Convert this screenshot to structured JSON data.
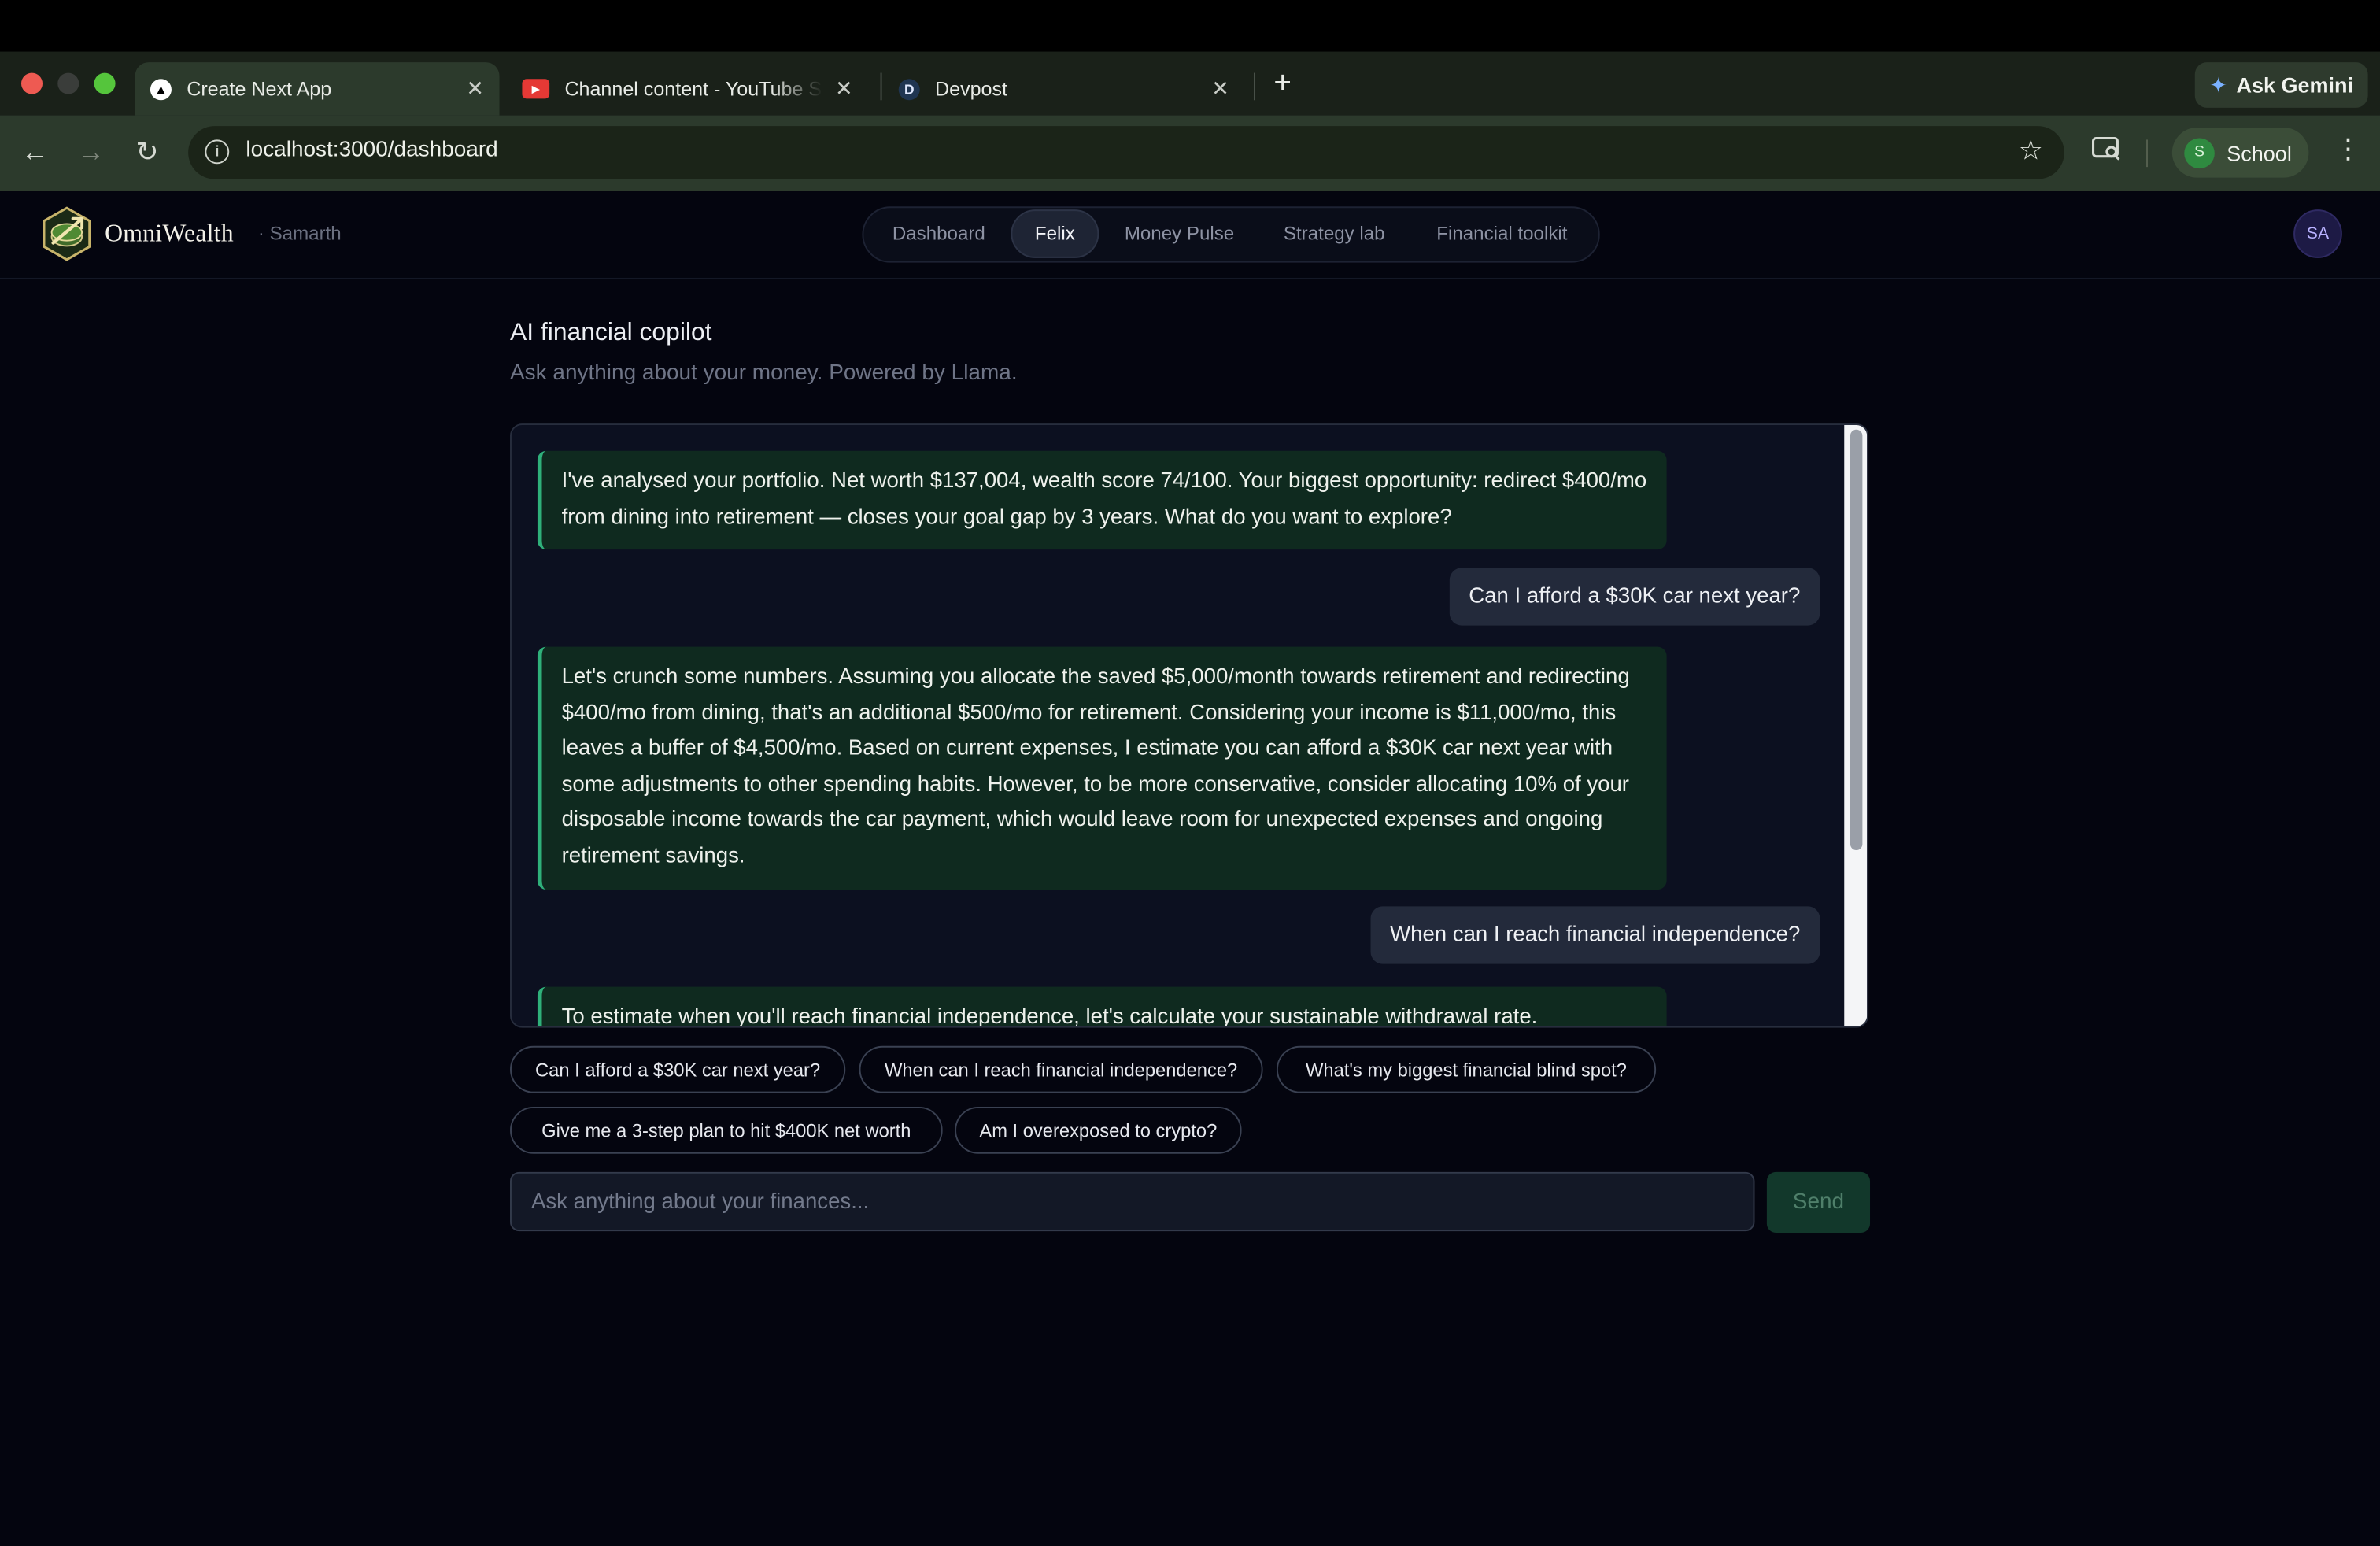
{
  "browser": {
    "tabs": [
      {
        "title": "Create Next App",
        "active": true,
        "favicon": "triangle-icon"
      },
      {
        "title": "Channel content - YouTube Studio",
        "active": false,
        "favicon": "youtube-icon"
      },
      {
        "title": "Devpost",
        "active": false,
        "favicon": "D"
      }
    ],
    "new_tab": "+",
    "ask_gemini": "Ask Gemini",
    "url": "localhost:3000/dashboard",
    "profile_initial": "S",
    "profile_name": "School"
  },
  "app": {
    "brand": "OmniWealth",
    "user": "· Samarth",
    "nav": [
      {
        "label": "Dashboard",
        "active": false
      },
      {
        "label": "Felix",
        "active": true
      },
      {
        "label": "Money Pulse",
        "active": false
      },
      {
        "label": "Strategy lab",
        "active": false
      },
      {
        "label": "Financial toolkit",
        "active": false
      }
    ],
    "avatar_initials": "SA"
  },
  "page": {
    "title": "AI financial copilot",
    "subtitle": "Ask anything about your money. Powered by Llama."
  },
  "messages": [
    {
      "role": "assistant",
      "text": "I've analysed your portfolio. Net worth $137,004, wealth score 74/100. Your biggest opportunity: redirect $400/mo from dining into retirement — closes your goal gap by 3 years. What do you want to explore?"
    },
    {
      "role": "user",
      "text": "Can I afford a $30K car next year?"
    },
    {
      "role": "assistant",
      "text": "Let's crunch some numbers. Assuming you allocate the saved $5,000/month towards retirement and redirecting $400/mo from dining, that's an additional $500/mo for retirement. Considering your income is $11,000/mo, this leaves a buffer of $4,500/mo. Based on current expenses, I estimate you can afford a $30K car next year with some adjustments to other spending habits. However, to be more conservative, consider allocating 10% of your disposable income towards the car payment, which would leave room for unexpected expenses and ongoing retirement savings."
    },
    {
      "role": "user",
      "text": "When can I reach financial independence?"
    },
    {
      "role": "assistant",
      "text": "To estimate when you'll reach financial independence, let's calculate your sustainable withdrawal rate."
    }
  ],
  "suggestions": [
    "Can I afford a $30K car next year?",
    "When can I reach financial independence?",
    "What's my biggest financial blind spot?",
    "Give me a 3-step plan to hit $400K net worth",
    "Am I overexposed to crypto?"
  ],
  "composer": {
    "placeholder": "Ask anything about your finances...",
    "send_label": "Send"
  }
}
